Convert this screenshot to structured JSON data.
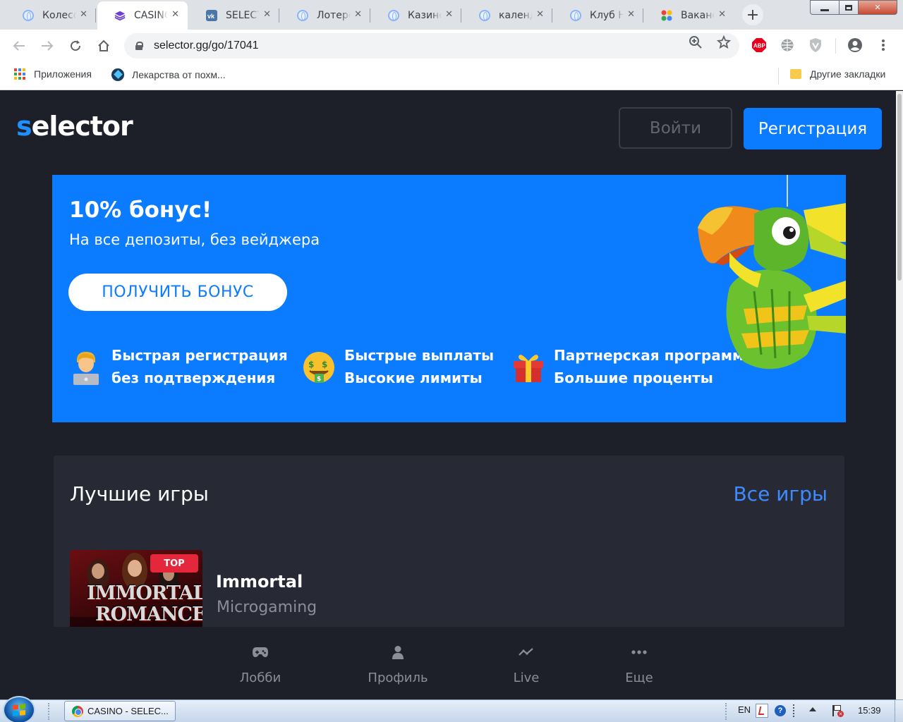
{
  "browser": {
    "tabs": [
      {
        "title": "Колесо",
        "icon": "globe-icon"
      },
      {
        "title": "CASINO",
        "icon": "layers-icon",
        "active": true
      },
      {
        "title": "SELECT",
        "icon": "vk-icon"
      },
      {
        "title": "Лотере",
        "icon": "globe-icon"
      },
      {
        "title": "Казино",
        "icon": "globe-icon"
      },
      {
        "title": "календ",
        "icon": "globe-icon"
      },
      {
        "title": "Клуб Н",
        "icon": "globe-icon"
      },
      {
        "title": "Ваканс",
        "icon": "dots-color-icon"
      }
    ],
    "tab_close_glyph": "✕",
    "url": "selector.gg/go/17041",
    "bookmarks": {
      "apps": "Приложения",
      "item1": "Лекарства от похм...",
      "other": "Другие закладки"
    },
    "abp_label": "ABP"
  },
  "site": {
    "logo_s": "s",
    "logo_rest": "elector",
    "login_label": "Войти",
    "register_label": "Регистрация",
    "banner": {
      "title": "10% бонус!",
      "subtitle": "На все депозиты, без вейджера",
      "cta": "ПОЛУЧИТЬ БОНУС",
      "features": [
        {
          "line1": "Быстрая регистрация",
          "line2": "без подтверждения",
          "icon": "man-laptop-icon"
        },
        {
          "line1": "Быстрые выплаты",
          "line2": "Высокие лимиты",
          "icon": "money-face-icon"
        },
        {
          "line1": "Партнерская программа",
          "line2": "Большие проценты",
          "icon": "gift-icon"
        }
      ]
    },
    "games_section": {
      "heading": "Лучшие игры",
      "all_link": "Все игры",
      "games": [
        {
          "name": "Immortal",
          "provider": "Microgaming",
          "badge": "TOP",
          "thumb_line1": "IMMORTAL",
          "thumb_line2": "ROMANCE"
        }
      ]
    },
    "bottom_nav": [
      {
        "label": "Лобби",
        "icon": "gamepad-icon"
      },
      {
        "label": "Профиль",
        "icon": "user-icon"
      },
      {
        "label": "Live",
        "icon": "pulse-icon"
      },
      {
        "label": "Еще",
        "icon": "more-dots-icon"
      }
    ],
    "colors": {
      "accent": "#0b7bff",
      "background": "#1e2029",
      "card": "#272a35"
    }
  },
  "taskbar": {
    "window_button": "CASINO - SELEC...",
    "lang": "EN",
    "time": "15:39"
  }
}
